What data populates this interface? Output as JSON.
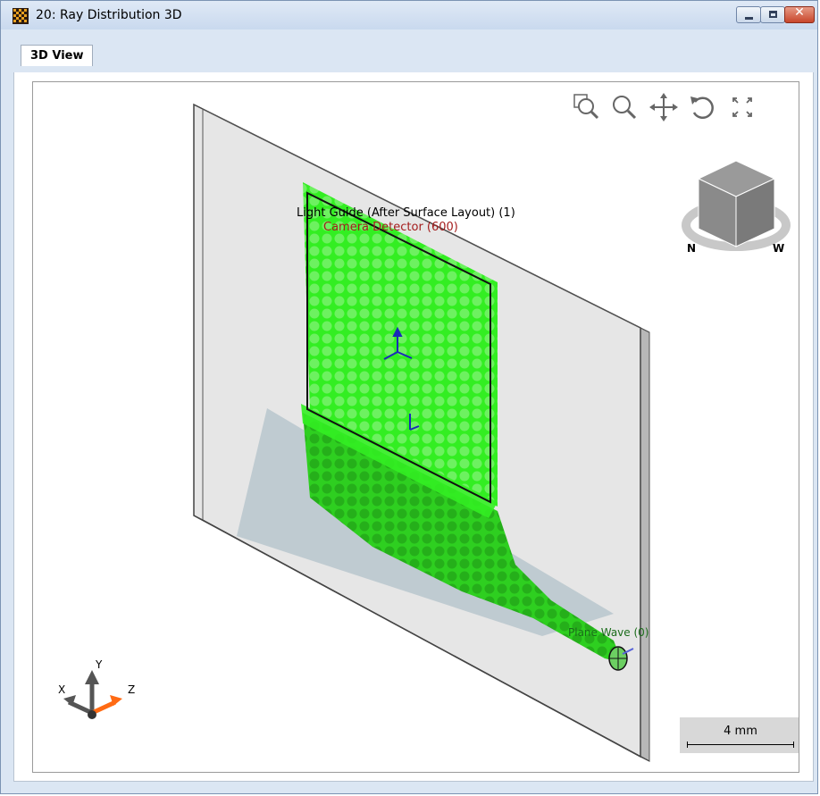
{
  "window": {
    "title": "20: Ray Distribution 3D",
    "controls": {
      "minimize": "minimize",
      "maximize": "maximize",
      "close": "close"
    }
  },
  "tabs": [
    {
      "label": "3D View",
      "active": true
    }
  ],
  "toolbar": {
    "icons": [
      "zoom-to-fit-icon",
      "zoom-icon",
      "pan-icon",
      "rotate-icon",
      "fullscreen-icon"
    ]
  },
  "scene": {
    "labels": {
      "light_guide": "Light Guide (After Surface Layout) (1)",
      "camera_detector": "Camera Detector (600)",
      "plane_wave": "Plane Wave (0)"
    },
    "colors": {
      "rays": "#33ee22",
      "detector_label": "#a41c1c",
      "source_label": "#1a6b1a",
      "plate": "#dcdcdc"
    }
  },
  "axes": {
    "x": "X",
    "y": "Y",
    "z": "Z"
  },
  "nav_cube": {
    "face_labels": [
      "N",
      "W"
    ]
  },
  "scale": {
    "label": "4 mm"
  }
}
